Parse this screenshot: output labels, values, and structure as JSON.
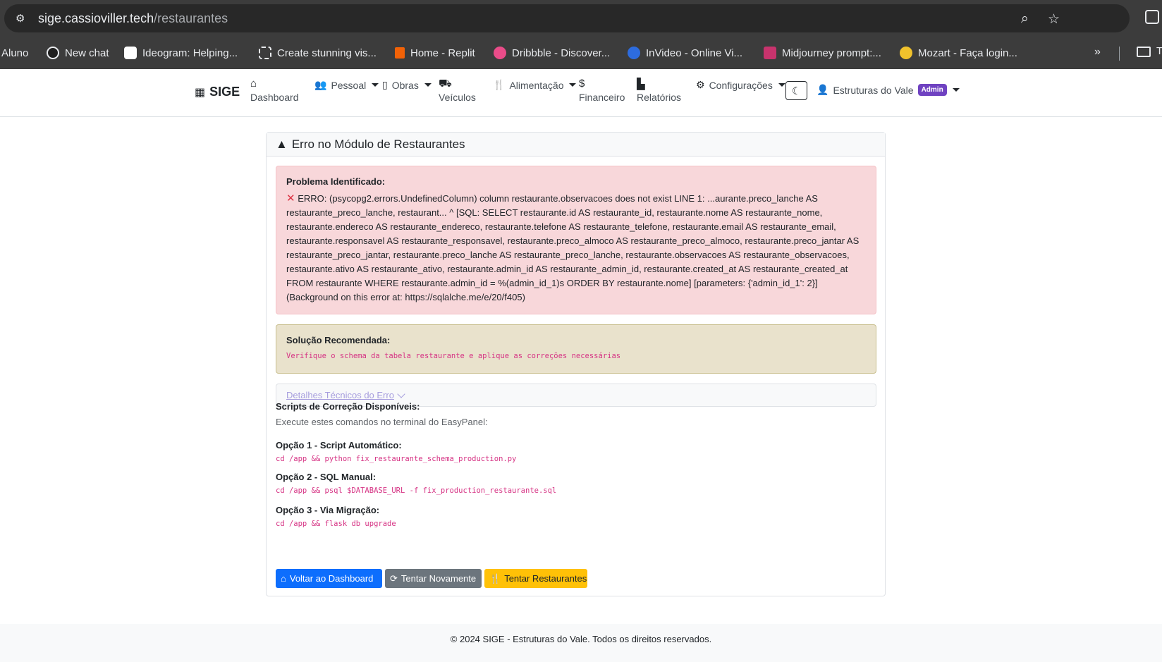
{
  "browser": {
    "url_host": "sige.cassioviller.tech",
    "url_path": "/restaurantes",
    "bookmarks": [
      {
        "label": "Aluno",
        "color": "#3c3c3c"
      },
      {
        "label": "New chat",
        "color": "#1f1f1f"
      },
      {
        "label": "Ideogram: Helping...",
        "color": "#ffffff"
      },
      {
        "label": "Create stunning vis...",
        "color": "#1f1f1f"
      },
      {
        "label": "Home - Replit",
        "color": "#f26207"
      },
      {
        "label": "Dribbble - Discover...",
        "color": "#ea4c89"
      },
      {
        "label": "InVideo - Online Vi...",
        "color": "#2d6cdf"
      },
      {
        "label": "Midjourney prompt:...",
        "color": "#c8336d"
      },
      {
        "label": "Mozart - Faça login...",
        "color": "#f0c22c"
      }
    ],
    "more_bookmarks": "»",
    "folder_label": "T"
  },
  "navbar": {
    "brand": "SIGE",
    "dashboard": "Dashboard",
    "pessoal": "Pessoal",
    "obras": "Obras",
    "veiculos": "Veículos",
    "alimentacao": "Alimentação",
    "financeiro": "Financeiro",
    "relatorios": "Relatórios",
    "configuracoes": "Configurações",
    "user_name": "Estruturas do Vale",
    "user_badge": "Admin"
  },
  "card": {
    "title": "Erro no Módulo de Restaurantes",
    "problem_title": "Problema Identificado:",
    "problem_text": "ERRO: (psycopg2.errors.UndefinedColumn) column restaurante.observacoes does not exist LINE 1: ...aurante.preco_lanche AS restaurante_preco_lanche, restaurant... ^ [SQL: SELECT restaurante.id AS restaurante_id, restaurante.nome AS restaurante_nome, restaurante.endereco AS restaurante_endereco, restaurante.telefone AS restaurante_telefone, restaurante.email AS restaurante_email, restaurante.responsavel AS restaurante_responsavel, restaurante.preco_almoco AS restaurante_preco_almoco, restaurante.preco_jantar AS restaurante_preco_jantar, restaurante.preco_lanche AS restaurante_preco_lanche, restaurante.observacoes AS restaurante_observacoes, restaurante.ativo AS restaurante_ativo, restaurante.admin_id AS restaurante_admin_id, restaurante.created_at AS restaurante_created_at FROM restaurante WHERE restaurante.admin_id = %(admin_id_1)s ORDER BY restaurante.nome] [parameters: {'admin_id_1': 2}] (Background on this error at: https://sqlalche.me/e/20/f405)",
    "solution_title": "Solução Recomendada:",
    "solution_text": "Verifique o schema da tabela restaurante e aplique as correções necessárias",
    "details_link": "Detalhes Técnicos do Erro",
    "scripts_title": "Scripts de Correção Disponíveis:",
    "scripts_subtitle": "Execute estes comandos no terminal do EasyPanel:",
    "option1_title": "Opção 1 - Script Automático:",
    "option1_code": "cd /app && python fix_restaurante_schema_production.py",
    "option2_title": "Opção 2 - SQL Manual:",
    "option2_code": "cd /app && psql $DATABASE_URL -f fix_production_restaurante.sql",
    "option3_title": "Opção 3 - Via Migração:",
    "option3_code": "cd /app && flask db upgrade",
    "btn_dashboard": "Voltar ao Dashboard",
    "btn_retry": "Tentar Novamente",
    "btn_restaurants": "Tentar Restaurantes"
  },
  "footer": {
    "text": "© 2024 SIGE - Estruturas do Vale. Todos os direitos reservados."
  }
}
